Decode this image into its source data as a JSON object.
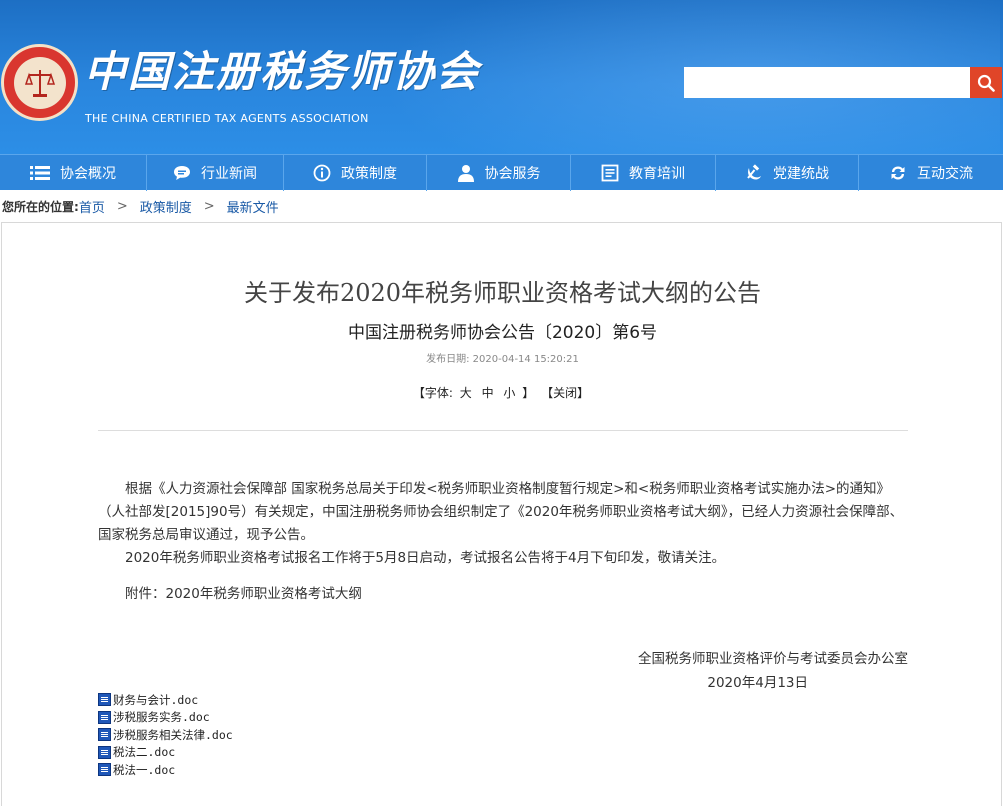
{
  "header": {
    "logo_cn": "中国注册税务师协会",
    "logo_en": "THE CHINA CERTIFIED TAX AGENTS ASSOCIATION",
    "search_value": "",
    "search_placeholder": ""
  },
  "nav": [
    {
      "label": "协会概况",
      "icon": "menu-list-icon"
    },
    {
      "label": "行业新闻",
      "icon": "speech-bubble-icon"
    },
    {
      "label": "政策制度",
      "icon": "info-circle-icon"
    },
    {
      "label": "协会服务",
      "icon": "person-icon"
    },
    {
      "label": "教育培训",
      "icon": "book-icon"
    },
    {
      "label": "党建统战",
      "icon": "hammer-sickle-icon"
    },
    {
      "label": "互动交流",
      "icon": "refresh-arrows-icon"
    }
  ],
  "breadcrumb": {
    "lead": "您所在的位置:",
    "items": [
      "首页",
      "政策制度",
      "最新文件"
    ],
    "sep": ">"
  },
  "article": {
    "title": "关于发布2020年税务师职业资格考试大纲的公告",
    "subtitle": "中国注册税务师协会公告〔2020〕第6号",
    "pubdate": "发布日期: 2020-04-14 15:20:21",
    "font_ctl_open": "【字体:",
    "font_large": "大",
    "font_medium": "中",
    "font_small": "小",
    "font_ctl_close": "】",
    "close_label": "【关闭】",
    "para1": "根据《人力资源社会保障部 国家税务总局关于印发<税务师职业资格制度暂行规定>和<税务师职业资格考试实施办法>的通知》（人社部发[2015]90号）有关规定，中国注册税务师协会组织制定了《2020年税务师职业资格考试大纲》，已经人力资源社会保障部、国家税务总局审议通过，现予公告。",
    "para2": "2020年税务师职业资格考试报名工作将于5月8日启动，考试报名公告将于4月下旬印发，敬请关注。",
    "attachment": "附件：2020年税务师职业资格考试大纲",
    "signer": "全国税务师职业资格评价与考试委员会办公室",
    "sign_date": "2020年4月13日"
  },
  "files": [
    "财务与会计.doc",
    "涉税服务实务.doc",
    "涉税服务相关法律.doc",
    "税法二.doc",
    "税法一.doc"
  ],
  "colors": {
    "header_blue": "#2a86de",
    "nav_blue": "#2e86db",
    "search_red": "#e04528",
    "link_blue": "#1a5aa6"
  }
}
